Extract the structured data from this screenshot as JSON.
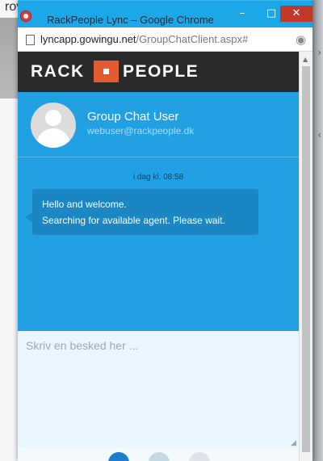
{
  "background": {
    "partial_text": "rover"
  },
  "window": {
    "title": "RackPeople Lync – Google Chrome",
    "min_label": "–",
    "max_label": "□",
    "close_label": "✕"
  },
  "address_bar": {
    "host": "lyncapp.gowingu.net",
    "path": "/GroupChatClient.aspx#"
  },
  "brand": {
    "left": "RACK",
    "right": "PEOPLE",
    "accent_color": "#e25b31"
  },
  "profile": {
    "name": "Group Chat User",
    "email": "webuser@rackpeople.dk"
  },
  "chat": {
    "timestamp": "i dag kl. 08:58",
    "message_lines": [
      "Hello and welcome.",
      "Searching for available agent. Please wait."
    ]
  },
  "input": {
    "placeholder": "Skriv en besked her ..."
  },
  "icons": {
    "browser": "chrome-icon",
    "page": "page-icon",
    "location": "location-icon",
    "avatar": "avatar-icon"
  }
}
